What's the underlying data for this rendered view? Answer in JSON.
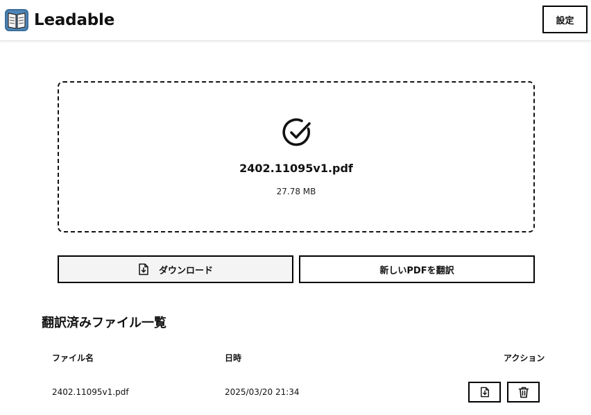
{
  "header": {
    "app_title": "Leadable",
    "settings_label": "設定"
  },
  "upload": {
    "file_name": "2402.11095v1.pdf",
    "file_size": "27.78 MB"
  },
  "actions": {
    "download_label": "ダウンロード",
    "new_translate_label": "新しいPDFを翻訳"
  },
  "history": {
    "title": "翻訳済みファイル一覧",
    "columns": {
      "name": "ファイル名",
      "date": "日時",
      "action": "アクション"
    },
    "rows": [
      {
        "name": "2402.11095v1.pdf",
        "date": "2025/03/20 21:34"
      }
    ]
  }
}
